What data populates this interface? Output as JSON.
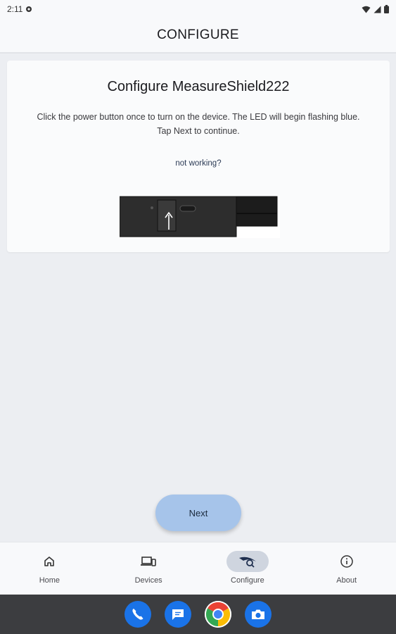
{
  "status_bar": {
    "time": "2:11"
  },
  "app_bar": {
    "title": "CONFIGURE"
  },
  "card": {
    "title": "Configure MeasureShield222",
    "instruction_line1": "Click the power button once to turn on the device. The LED will begin flashing blue.",
    "instruction_line2": "Tap Next to continue.",
    "help_link": "not working?"
  },
  "next_button": {
    "label": "Next"
  },
  "bottom_nav": {
    "items": [
      {
        "label": "Home",
        "icon": "home-icon",
        "active": false
      },
      {
        "label": "Devices",
        "icon": "devices-icon",
        "active": false
      },
      {
        "label": "Configure",
        "icon": "configure-icon",
        "active": true
      },
      {
        "label": "About",
        "icon": "info-icon",
        "active": false
      }
    ]
  },
  "dock": {
    "apps": [
      {
        "icon": "phone-icon",
        "color": "#1a73e8"
      },
      {
        "icon": "messages-icon",
        "color": "#1a73e8"
      },
      {
        "icon": "chrome-icon",
        "color": "#ffffff"
      },
      {
        "icon": "camera-icon",
        "color": "#1a73e8"
      }
    ]
  },
  "colors": {
    "fab": "#a6c4ea",
    "active_nav_pill": "#cfd5df",
    "background": "#eceef2"
  }
}
